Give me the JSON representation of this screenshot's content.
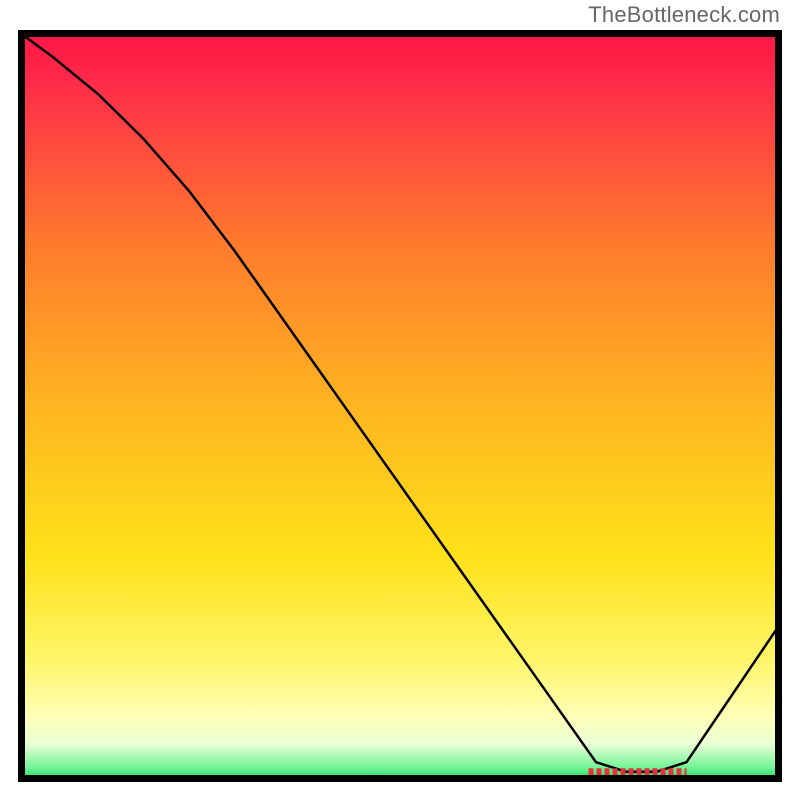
{
  "watermark": "TheBottleneck.com",
  "chart_data": {
    "type": "line",
    "title": "",
    "xlabel": "",
    "ylabel": "",
    "xlim": [
      0,
      100
    ],
    "ylim": [
      0,
      100
    ],
    "grid": false,
    "series": [
      {
        "name": "curve",
        "x": [
          0,
          4,
          10,
          16,
          22,
          28,
          60,
          76,
          80,
          84,
          88,
          100
        ],
        "y": [
          100,
          97,
          92,
          86,
          79,
          71,
          25,
          2,
          0.7,
          0.7,
          2,
          20
        ]
      }
    ],
    "highlight_band": {
      "x0": 75,
      "x1": 88,
      "y": 0.7
    },
    "gradient_stops": [
      {
        "offset": 0.0,
        "color": "#ff1744"
      },
      {
        "offset": 0.06,
        "color": "#ff2a4a"
      },
      {
        "offset": 0.28,
        "color": "#ff7a2d"
      },
      {
        "offset": 0.5,
        "color": "#ffb521"
      },
      {
        "offset": 0.7,
        "color": "#ffe119"
      },
      {
        "offset": 0.84,
        "color": "#fff568"
      },
      {
        "offset": 0.92,
        "color": "#ffffb8"
      },
      {
        "offset": 0.955,
        "color": "#eaffd5"
      },
      {
        "offset": 0.985,
        "color": "#7cf59a"
      },
      {
        "offset": 1.0,
        "color": "#2ee06e"
      }
    ],
    "colors": {
      "curve": "#000000",
      "highlight": "#e8313e",
      "border": "#000000"
    }
  }
}
